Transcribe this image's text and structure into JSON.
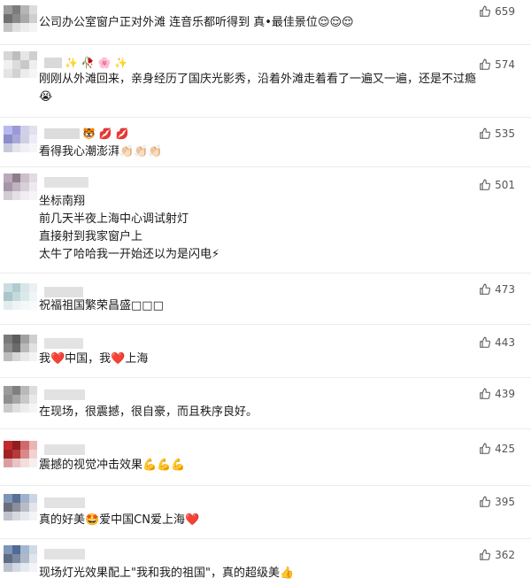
{
  "comments": [
    {
      "text": "公司办公室窗户正对外滩 连音乐都听得到 真•最佳景位",
      "trail": "😌😌😌",
      "likes": "659",
      "extra": []
    },
    {
      "text": "刚刚从外滩回来，亲身经历了国庆光影秀，沿着外滩走着看了一遍又一遍，还是不过瘾",
      "trail": "",
      "likes": "574",
      "extra": [
        "😭"
      ],
      "name_emoji": "✨ 🥀 🌸 ✨"
    },
    {
      "text": "看得我心潮澎湃",
      "trail": "👏🏻👏🏻👏🏻",
      "likes": "535",
      "extra": [],
      "name_emoji": "🐯 💋 💋"
    },
    {
      "text": "坐标南翔",
      "trail": "",
      "likes": "501",
      "extra": [
        "前几天半夜上海中心调试射灯",
        "直接射到我家窗户上",
        "太牛了哈哈我一开始还以为是闪电⚡"
      ]
    },
    {
      "text": "祝福祖国繁荣昌盛□□□",
      "trail": "",
      "likes": "473",
      "extra": []
    },
    {
      "text": "我❤️中国，我❤️上海",
      "trail": "",
      "likes": "443",
      "extra": []
    },
    {
      "text": "在现场，很震撼，很自豪，而且秩序良好。",
      "trail": "",
      "likes": "439",
      "extra": []
    },
    {
      "text": "震撼的视觉冲击效果",
      "trail": "💪💪💪",
      "likes": "425",
      "extra": []
    },
    {
      "text": "真的好美🤩爱中国CN爱上海❤️",
      "trail": "",
      "likes": "395",
      "extra": []
    },
    {
      "text": "现场灯光效果配上\"我和我的祖国\"，真的超级美👍",
      "trail": "",
      "likes": "362",
      "extra": []
    }
  ],
  "colors": {
    "accent": "#e0245e",
    "like": "#555555"
  },
  "icons": {
    "like": "thumbs-up-icon"
  }
}
